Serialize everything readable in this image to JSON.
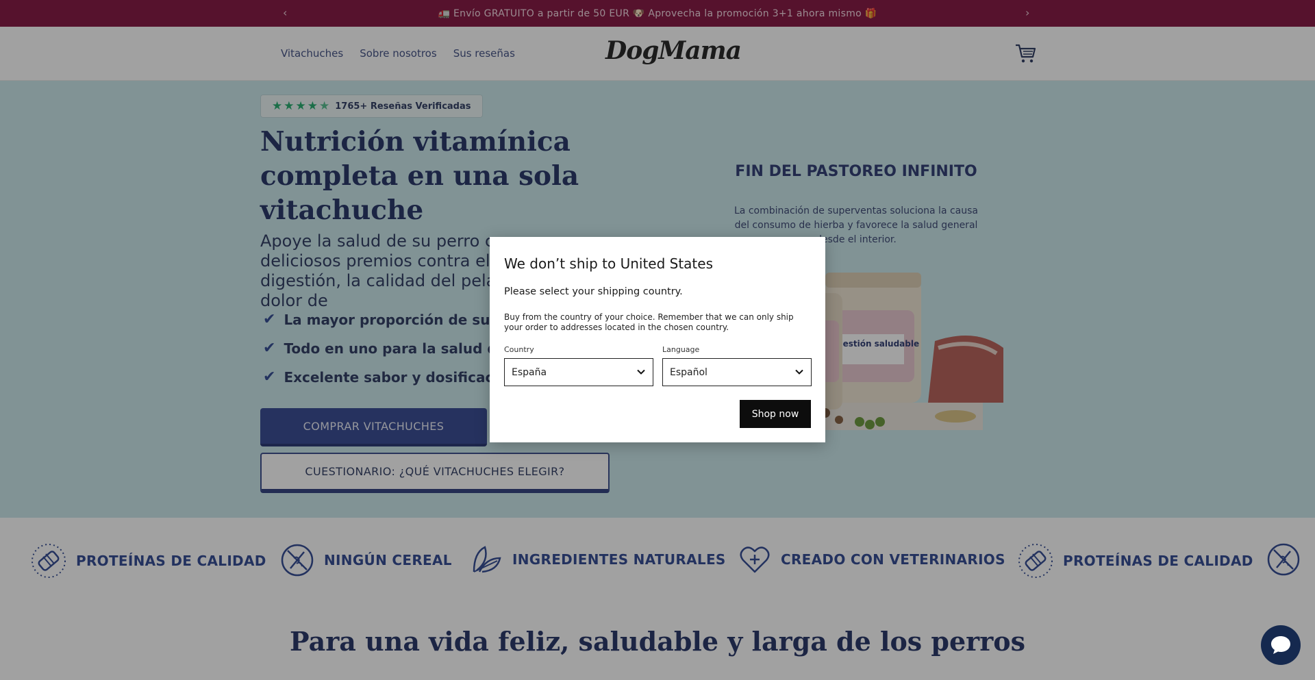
{
  "announcement": {
    "text": "🚛 Envío GRATUITO a partir de 50 EUR 🐶 Aprovecha la promoción 3+1 ahora mismo 🎁",
    "prev_arrow": "‹",
    "next_arrow": "›"
  },
  "header": {
    "nav": [
      "Vitachuches",
      "Sobre nosotros",
      "Sus reseñas"
    ],
    "logo_text": "DogMama",
    "cart_icon": "cart-icon"
  },
  "hero": {
    "reviews": {
      "rating_stars": 4.5,
      "label": "1765+ Reseñas Verificadas"
    },
    "title": "Nutrición vitamínica completa en una sola vitachuche",
    "subtitle": "Apoye la salud de su perro con deliciosos premios contra el picor, la digestión, la calidad del pelaje y el dolor de",
    "benefits": [
      "La mayor proporción de sustancias activas",
      "Todo en uno para la salud de su perro",
      "Excelente sabor y dosificación sencilla"
    ],
    "primary_button": "COMPRAR VITACHUCHES",
    "secondary_button": "CUESTIONARIO: ¿QUÉ VITACHUCHES ELEGIR?",
    "promo": {
      "title": "FIN DEL PASTOREO INFINITO",
      "text": "La combinación de superventas soluciona la causa del consumo de hierba y favorece la salud general desde el interior.",
      "jar_label": "Digestión saludable"
    }
  },
  "features": [
    {
      "label": "PROTEÍNAS DE CALIDAD",
      "icon": "protein-icon"
    },
    {
      "label": "NINGÚN CEREAL",
      "icon": "no-grain-icon"
    },
    {
      "label": "INGREDIENTES NATURALES",
      "icon": "leaf-icon"
    },
    {
      "label": "CREADO CON VETERINARIOS",
      "icon": "heart-plus-icon"
    },
    {
      "label": "PROTEÍNAS DE CALIDAD",
      "icon": "protein-icon"
    }
  ],
  "section": {
    "title": "Para una vida feliz, saludable y larga de los perros"
  },
  "modal": {
    "title": "We don’t ship to United States",
    "instruction": "Please select your shipping country.",
    "note": "Buy from the country of your choice. Remember that we can only ship your order to addresses located in the chosen country.",
    "country_label": "Country",
    "country_value": "España",
    "language_label": "Language",
    "language_value": "Español",
    "shop_button": "Shop now"
  },
  "colors": {
    "announcement_bg": "#7a0030",
    "hero_bg": "#c6e7ea",
    "primary": "#24398a",
    "star": "#11a560"
  }
}
